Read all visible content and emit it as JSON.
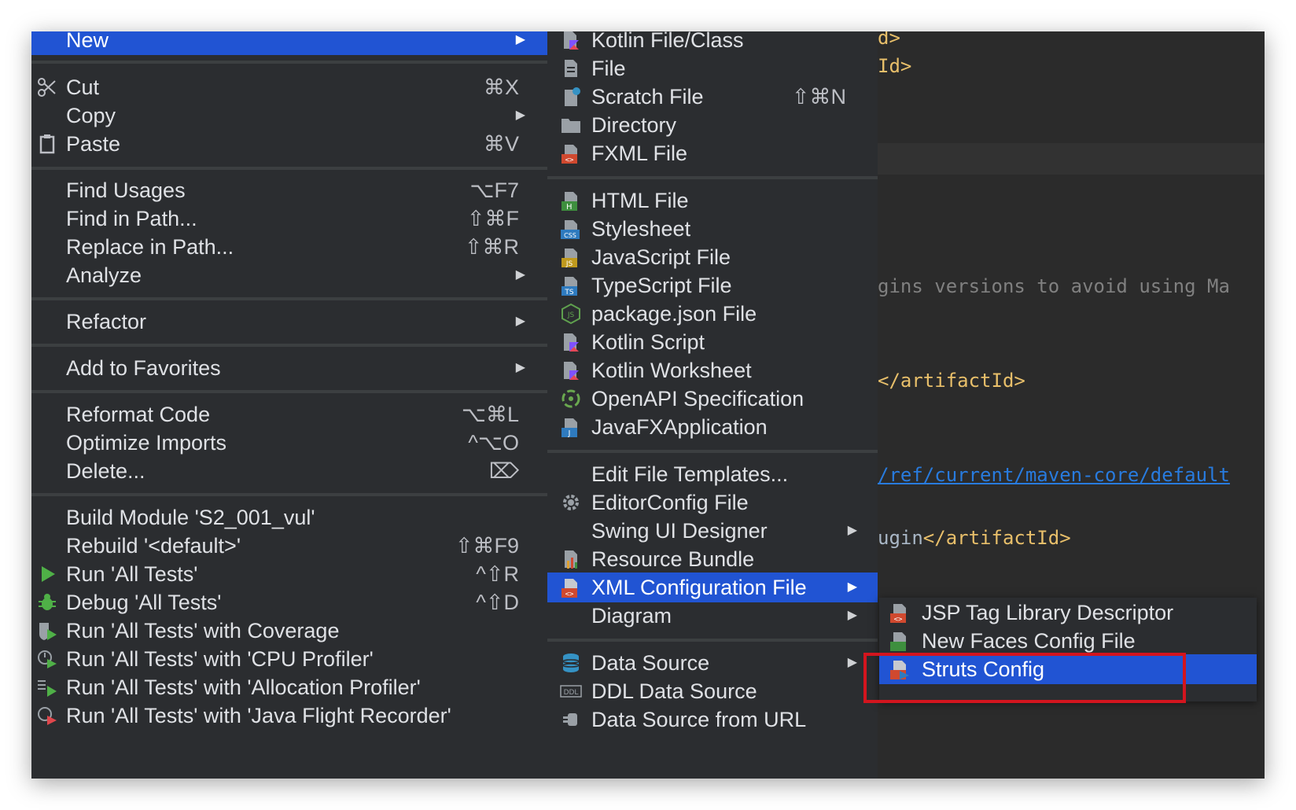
{
  "editor": {
    "lines": [
      {
        "text": "d>",
        "cls": "tag"
      },
      {
        "text": "Id>",
        "cls": "tag"
      },
      {
        "text": "gins versions to avoid using Ma",
        "cls": "comment"
      },
      {
        "text": "</artifactId>",
        "cls": "tag"
      },
      {
        "text": "/ref/current/maven-core/default",
        "cls": "link"
      },
      {
        "text": "ugin</artifactId>",
        "cls": "mixed"
      }
    ],
    "mixed_prefix": "ugin",
    "mixed_tag": "</artifactId>"
  },
  "main_menu": {
    "new": {
      "label": "New"
    },
    "cut": {
      "label": "Cut",
      "shortcut": "⌘X"
    },
    "copy": {
      "label": "Copy"
    },
    "paste": {
      "label": "Paste",
      "shortcut": "⌘V"
    },
    "find_usages": {
      "label": "Find Usages",
      "shortcut": "⌥F7"
    },
    "find_in_path": {
      "label": "Find in Path...",
      "shortcut": "⇧⌘F"
    },
    "replace_in_path": {
      "label": "Replace in Path...",
      "shortcut": "⇧⌘R"
    },
    "analyze": {
      "label": "Analyze"
    },
    "refactor": {
      "label": "Refactor"
    },
    "add_to_favorites": {
      "label": "Add to Favorites"
    },
    "reformat_code": {
      "label": "Reformat Code",
      "shortcut": "⌥⌘L"
    },
    "optimize_imports": {
      "label": "Optimize Imports",
      "shortcut": "^⌥O"
    },
    "delete": {
      "label": "Delete...",
      "shortcut": "⌦"
    },
    "build_module": {
      "label": "Build Module 'S2_001_vul'"
    },
    "rebuild": {
      "label": "Rebuild '<default>'",
      "shortcut": "⇧⌘F9"
    },
    "run_all": {
      "label": "Run 'All Tests'",
      "shortcut": "^⇧R"
    },
    "debug_all": {
      "label": "Debug 'All Tests'",
      "shortcut": "^⇧D"
    },
    "run_coverage": {
      "label": "Run 'All Tests' with Coverage"
    },
    "run_cpu": {
      "label": "Run 'All Tests' with 'CPU Profiler'"
    },
    "run_alloc": {
      "label": "Run 'All Tests' with 'Allocation Profiler'"
    },
    "run_jfr": {
      "label": "Run 'All Tests' with 'Java Flight Recorder'"
    }
  },
  "new_menu": {
    "kotlin_class": {
      "label": "Kotlin File/Class"
    },
    "file": {
      "label": "File"
    },
    "scratch": {
      "label": "Scratch File",
      "shortcut": "⇧⌘N"
    },
    "directory": {
      "label": "Directory"
    },
    "fxml": {
      "label": "FXML File"
    },
    "html": {
      "label": "HTML File"
    },
    "stylesheet": {
      "label": "Stylesheet"
    },
    "javascript": {
      "label": "JavaScript File"
    },
    "typescript": {
      "label": "TypeScript File"
    },
    "package_json": {
      "label": "package.json File"
    },
    "kotlin_script": {
      "label": "Kotlin Script"
    },
    "kotlin_worksheet": {
      "label": "Kotlin Worksheet"
    },
    "openapi": {
      "label": "OpenAPI Specification"
    },
    "javafx": {
      "label": "JavaFXApplication"
    },
    "edit_templates": {
      "label": "Edit File Templates..."
    },
    "editorconfig": {
      "label": "EditorConfig File"
    },
    "swing": {
      "label": "Swing UI Designer"
    },
    "resource_bundle": {
      "label": "Resource Bundle"
    },
    "xml_config": {
      "label": "XML Configuration File"
    },
    "diagram": {
      "label": "Diagram"
    },
    "data_source": {
      "label": "Data Source"
    },
    "ddl": {
      "label": "DDL Data Source"
    },
    "ds_url": {
      "label": "Data Source from URL"
    }
  },
  "xml_menu": {
    "jsp_tld": {
      "label": "JSP Tag Library Descriptor"
    },
    "faces": {
      "label": "New Faces Config File"
    },
    "struts": {
      "label": "Struts Config"
    }
  },
  "icons": {
    "kotlin": "K",
    "css": "CSS",
    "js": "JS",
    "ts": "TS",
    "html": "H",
    "java": "J",
    "ddl": "DDL",
    "xml": "<>"
  },
  "colors": {
    "selection": "#2154d3",
    "highlight_box": "#d3151e",
    "menu_bg": "#2b2d30"
  }
}
